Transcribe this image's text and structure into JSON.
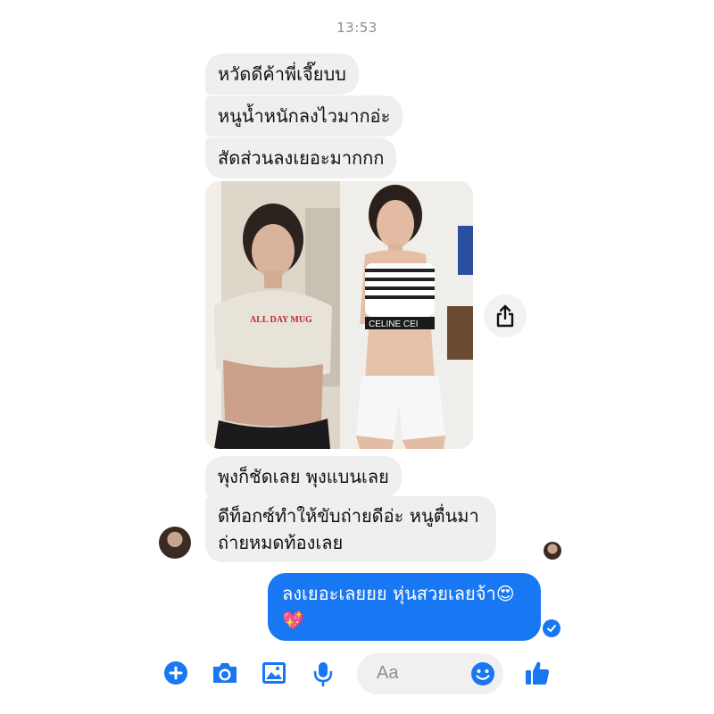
{
  "header": {
    "timestamp": "13:53"
  },
  "messages": {
    "incoming": [
      {
        "text": "หวัดดีค้าพี่เจี๊ยบบ"
      },
      {
        "text": "หนูน้ำหนักลงไวมากอ่ะ"
      },
      {
        "text": "สัดส่วนลงเยอะมากกก"
      },
      {
        "text": "พุงก็ชัดเลย พุงแบนเลย"
      },
      {
        "text": "ดีท็อกซ์ทำให้ขับถ่ายดีอ่ะ หนูตื่นมาถ่ายหมดท้องเลย"
      }
    ],
    "photo": {
      "left_shirt_text": "ALL DAY MUG",
      "right_top_text": "CELINE CEI"
    },
    "outgoing": {
      "text": "ลงเยอะเลยยย หุ่นสวยเลยจ้า😍💖"
    }
  },
  "icons": {
    "share": "share-icon",
    "add": "plus-circle-icon",
    "camera": "camera-icon",
    "gallery": "image-icon",
    "mic": "microphone-icon",
    "emoji": "emoji-icon",
    "like": "thumbs-up-icon",
    "sent": "check-circle-icon"
  },
  "composer": {
    "placeholder": "Aa"
  },
  "colors": {
    "accent": "#1877f2",
    "incoming_bubble": "#efefef",
    "timestamp": "#8e8e93"
  }
}
